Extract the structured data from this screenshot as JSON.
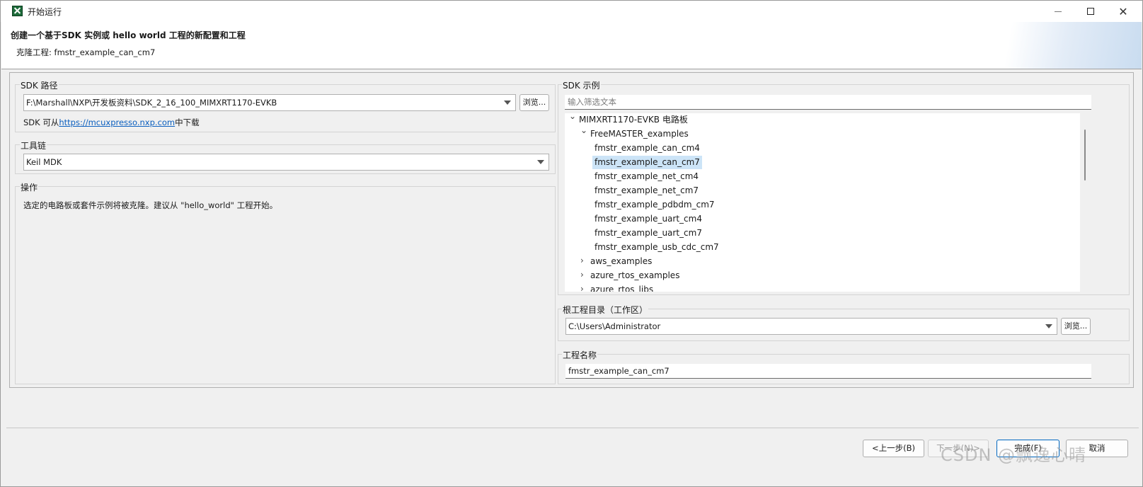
{
  "window": {
    "title": "开始运行",
    "icon": "app-x-icon"
  },
  "banner": {
    "title": "创建一个基于SDK 实例或 hello world 工程的新配置和工程",
    "subtitle": "克隆工程: fmstr_example_can_cm7"
  },
  "sdk_path": {
    "label": "SDK 路径",
    "value": "F:\\Marshall\\NXP\\开发板资料\\SDK_2_16_100_MIMXRT1170-EVKB",
    "browse_label": "浏览...",
    "download_prefix": "SDK 可从",
    "download_link": "https://mcuxpresso.nxp.com",
    "download_suffix": "中下载"
  },
  "toolchain": {
    "label": "工具链",
    "value": "Keil MDK"
  },
  "operation": {
    "label": "操作",
    "text": "选定的电路板或套件示例将被克隆。建议从 \"hello_world\" 工程开始。"
  },
  "sdk_examples": {
    "label": "SDK 示例",
    "filter_placeholder": "输入筛选文本",
    "tree": [
      {
        "label": "MIMXRT1170-EVKB 电路板",
        "level": 0,
        "expanded": true
      },
      {
        "label": "FreeMASTER_examples",
        "level": 1,
        "expanded": true
      },
      {
        "label": "fmstr_example_can_cm4",
        "level": 2
      },
      {
        "label": "fmstr_example_can_cm7",
        "level": 2,
        "selected": true
      },
      {
        "label": "fmstr_example_net_cm4",
        "level": 2
      },
      {
        "label": "fmstr_example_net_cm7",
        "level": 2
      },
      {
        "label": "fmstr_example_pdbdm_cm7",
        "level": 2
      },
      {
        "label": "fmstr_example_uart_cm4",
        "level": 2
      },
      {
        "label": "fmstr_example_uart_cm7",
        "level": 2
      },
      {
        "label": "fmstr_example_usb_cdc_cm7",
        "level": 2
      },
      {
        "label": "aws_examples",
        "level": 1,
        "expanded": false
      },
      {
        "label": "azure_rtos_examples",
        "level": 1,
        "expanded": false
      },
      {
        "label": "azure_rtos_libs",
        "level": 1,
        "expanded": false
      }
    ]
  },
  "root_dir": {
    "label": "根工程目录（工作区）",
    "value": "C:\\Users\\Administrator",
    "browse_label": "浏览..."
  },
  "project_name": {
    "label": "工程名称",
    "value": "fmstr_example_can_cm7"
  },
  "buttons": {
    "back": "<上一步(B)",
    "next": "下一步(N)>",
    "finish": "完成(F)",
    "cancel": "取消"
  },
  "watermark": "CSDN @飘逸心晴",
  "colors": {
    "selection": "#cce4f7",
    "link": "#0b5fbf",
    "primary_border": "#0067c0"
  }
}
